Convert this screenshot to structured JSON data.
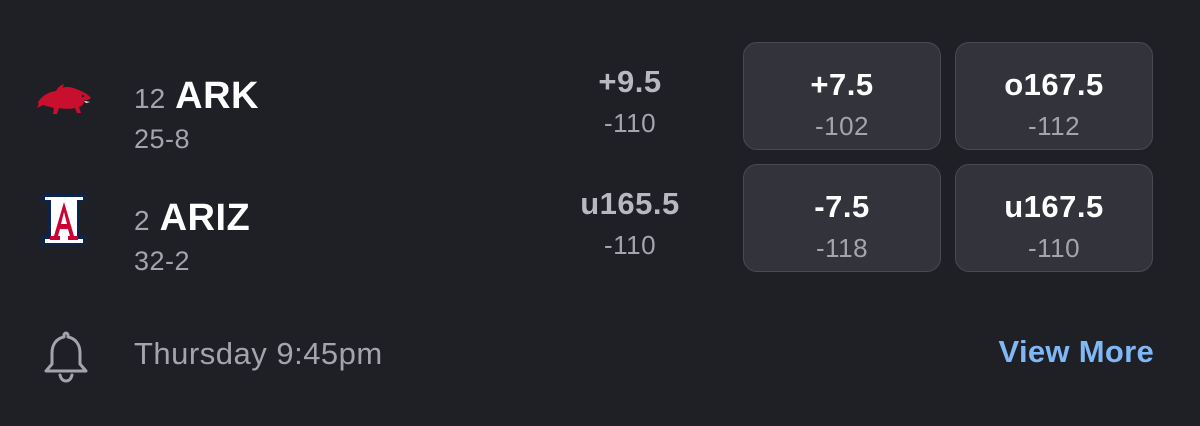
{
  "teams": [
    {
      "rank": "12",
      "abbr": "ARK",
      "record": "25-8",
      "logo_icon": "razorback-icon",
      "logo_color": "#c8102e",
      "plain": {
        "line": "+9.5",
        "price": "-110"
      },
      "spread": {
        "line": "+7.5",
        "price": "-102"
      },
      "total": {
        "line": "o167.5",
        "price": "-112"
      }
    },
    {
      "rank": "2",
      "abbr": "ARIZ",
      "record": "32-2",
      "logo_icon": "arizona-a-icon",
      "logo_color": "#cc0033",
      "plain": {
        "line": "u165.5",
        "price": "-110"
      },
      "spread": {
        "line": "-7.5",
        "price": "-118"
      },
      "total": {
        "line": "u167.5",
        "price": "-110"
      }
    }
  ],
  "footer": {
    "bell_icon": "bell-icon",
    "game_time": "Thursday 9:45pm",
    "view_more": "View More"
  },
  "colors": {
    "background": "#1f1f26",
    "button_bg": "#33333c",
    "accent_link": "#7fb8f5",
    "muted_text": "#a4a4ad"
  }
}
